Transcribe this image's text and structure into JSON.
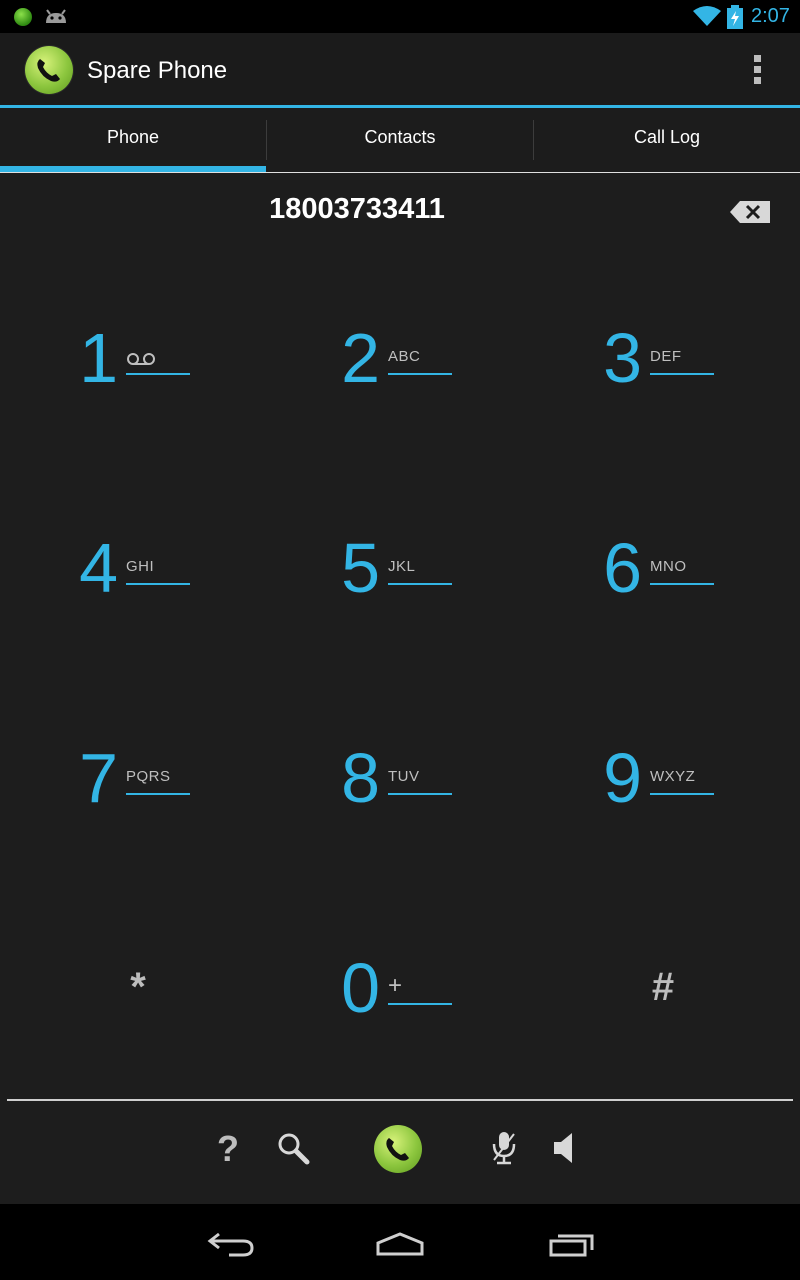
{
  "status_bar": {
    "time": "2:07",
    "icons": [
      "notification-dot-icon",
      "android-icon",
      "wifi-icon",
      "battery-charging-icon"
    ]
  },
  "action_bar": {
    "title": "Spare Phone",
    "app_icon": "phone-handset-icon",
    "overflow_icon": "overflow-menu-icon"
  },
  "tabs": [
    {
      "label": "Phone",
      "selected": true
    },
    {
      "label": "Contacts",
      "selected": false
    },
    {
      "label": "Call Log",
      "selected": false
    }
  ],
  "dialer": {
    "number": "18003733411",
    "backspace_icon": "backspace-icon"
  },
  "keypad": {
    "keys": [
      {
        "digit": "1",
        "letters": "",
        "icon": "voicemail-icon"
      },
      {
        "digit": "2",
        "letters": "ABC"
      },
      {
        "digit": "3",
        "letters": "DEF"
      },
      {
        "digit": "4",
        "letters": "GHI"
      },
      {
        "digit": "5",
        "letters": "JKL"
      },
      {
        "digit": "6",
        "letters": "MNO"
      },
      {
        "digit": "7",
        "letters": "PQRS"
      },
      {
        "digit": "8",
        "letters": "TUV"
      },
      {
        "digit": "9",
        "letters": "WXYZ"
      },
      {
        "digit": "0",
        "letters": "+"
      }
    ],
    "star": "*",
    "hash": "#"
  },
  "bottom_actions": {
    "help": "?",
    "icons": [
      "help-icon",
      "search-icon",
      "call-icon",
      "mic-icon",
      "speaker-icon"
    ]
  },
  "colors": {
    "accent": "#33b5e5",
    "background": "#1d1d1d",
    "call_green": "#8cc63e"
  }
}
